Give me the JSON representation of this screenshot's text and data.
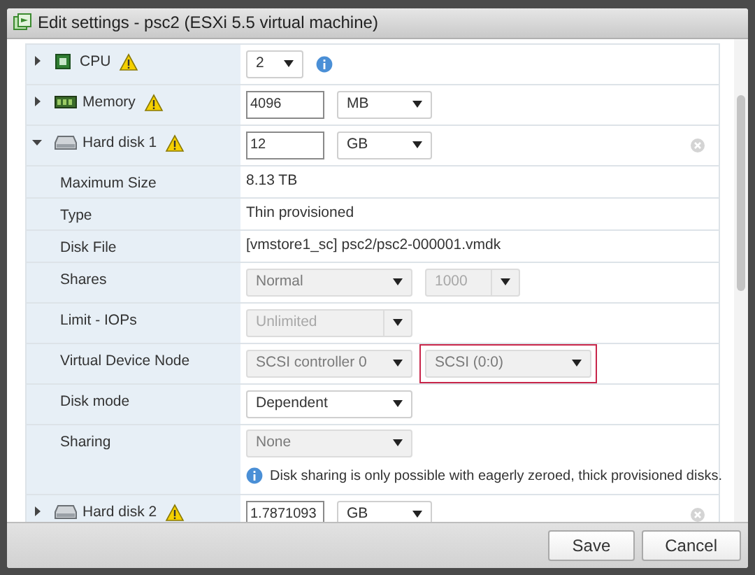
{
  "window": {
    "title": "Edit settings - psc2 (ESXi 5.5 virtual machine)"
  },
  "rows": [
    {
      "kind": "cpu",
      "label": "CPU",
      "expanded": false,
      "warning": true,
      "removable": false,
      "controls": [
        {
          "kind": "count",
          "value": "2",
          "disabled": false,
          "highlighted": false
        },
        {
          "kind": "info"
        }
      ]
    },
    {
      "kind": "memory",
      "label": "Memory",
      "expanded": false,
      "warning": true,
      "removable": false,
      "controls": [
        {
          "kind": "input",
          "value": "4096"
        },
        {
          "kind": "unit",
          "value": "MB",
          "disabled": false,
          "highlighted": false
        }
      ]
    },
    {
      "kind": "disk",
      "label": "Hard disk 1",
      "expanded": true,
      "warning": true,
      "removable": true,
      "controls": [
        {
          "kind": "input",
          "value": "12"
        },
        {
          "kind": "unit",
          "value": "GB",
          "disabled": false,
          "highlighted": false
        }
      ]
    },
    {
      "kind": "property",
      "label": "Maximum Size",
      "controls": [
        {
          "kind": "text",
          "value": "8.13 TB"
        }
      ]
    },
    {
      "kind": "property",
      "label": "Type",
      "controls": [
        {
          "kind": "text",
          "value": "Thin provisioned"
        }
      ]
    },
    {
      "kind": "property",
      "label": "Disk File",
      "controls": [
        {
          "kind": "text",
          "value": "[vmstore1_sc] psc2/psc2-000001.vmdk"
        }
      ]
    },
    {
      "kind": "property",
      "label": "Shares",
      "controls": [
        {
          "kind": "select",
          "value": "Normal",
          "disabled": true,
          "highlighted": false
        },
        {
          "kind": "combo",
          "value": "1000",
          "disabled": true,
          "highlighted": false
        }
      ]
    },
    {
      "kind": "property",
      "label": "Limit - IOPs",
      "controls": [
        {
          "kind": "combo-wide",
          "value": "Unlimited",
          "disabled": true,
          "highlighted": false
        }
      ]
    },
    {
      "kind": "property",
      "label": "Virtual Device Node",
      "controls": [
        {
          "kind": "select",
          "value": "SCSI controller 0",
          "disabled": true,
          "highlighted": false
        },
        {
          "kind": "select",
          "value": "SCSI (0:0)",
          "disabled": true,
          "highlighted": true
        }
      ]
    },
    {
      "kind": "property",
      "label": "Disk mode",
      "controls": [
        {
          "kind": "select",
          "value": "Dependent",
          "disabled": false,
          "highlighted": false
        }
      ]
    },
    {
      "kind": "property",
      "label": "Sharing",
      "controls": [
        {
          "kind": "select",
          "value": "None",
          "disabled": true,
          "highlighted": false
        },
        {
          "kind": "note",
          "value": "Disk sharing is only possible with eagerly zeroed, thick provisioned disks."
        }
      ]
    },
    {
      "kind": "disk",
      "label": "Hard disk 2",
      "expanded": false,
      "warning": true,
      "removable": true,
      "controls": [
        {
          "kind": "input",
          "value": "1.7871093"
        },
        {
          "kind": "unit",
          "value": "GB",
          "disabled": false,
          "highlighted": false
        }
      ]
    }
  ],
  "buttons": [
    {
      "label": "Save"
    },
    {
      "label": "Cancel"
    }
  ]
}
